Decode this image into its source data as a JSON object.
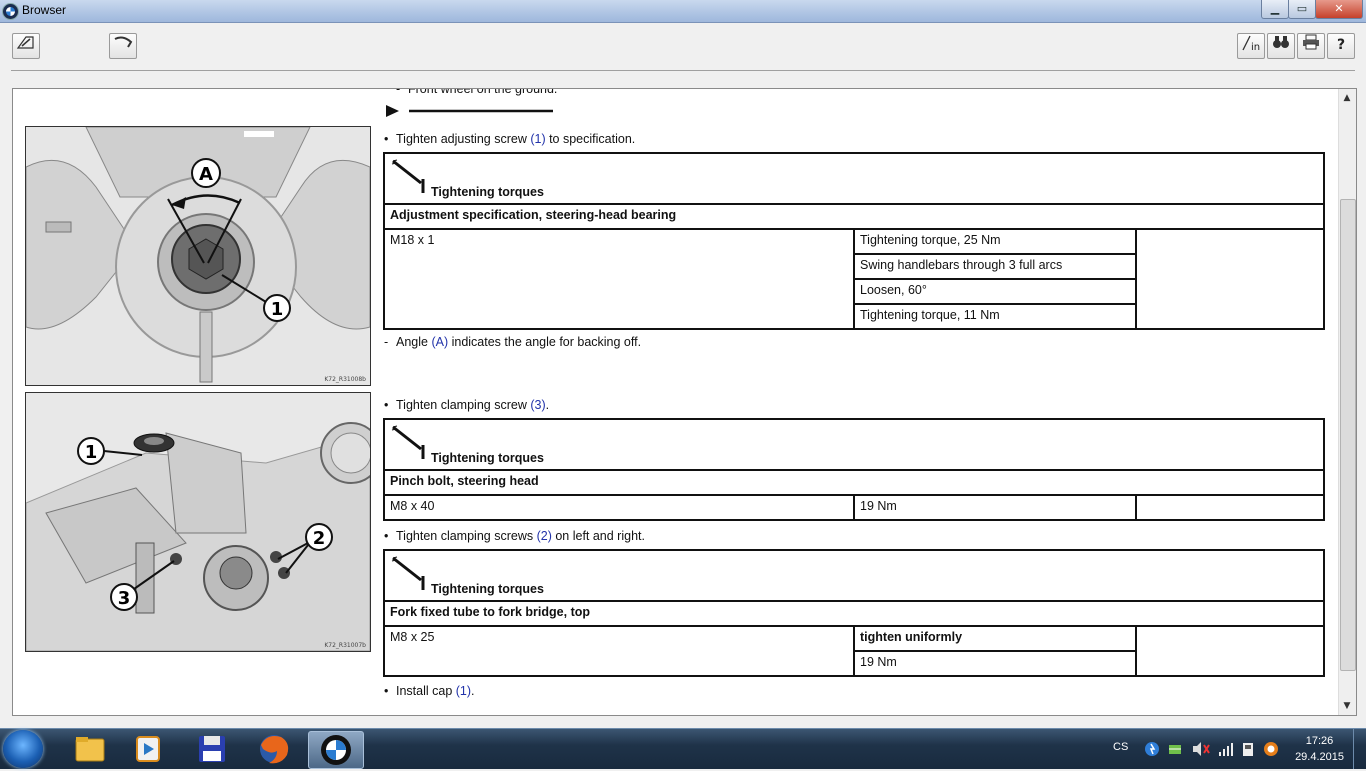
{
  "window": {
    "title": "Browser",
    "minimize": "▁",
    "maximize": "▭",
    "close": "✕"
  },
  "toolbar": {
    "left": [
      {
        "icon": "edit-icon",
        "glyph": "✎"
      },
      {
        "icon": "tool-icon",
        "glyph": "⌐"
      }
    ],
    "right": [
      {
        "icon": "info-in-icon",
        "glyph": "in"
      },
      {
        "icon": "binoculars-icon",
        "glyph": "⌕"
      },
      {
        "icon": "print-icon",
        "glyph": "⎙"
      },
      {
        "icon": "help-icon",
        "glyph": "?"
      }
    ]
  },
  "content": {
    "top_cut_text": "Front wheel on the ground.",
    "figures": [
      {
        "code": "K72_R31008b"
      },
      {
        "code": "K72_R31007b"
      }
    ],
    "step1": {
      "pre": "Tighten adjusting screw ",
      "ref": "(1)",
      "post": " to specification."
    },
    "table1": {
      "header": "Tightening torques",
      "title": "Adjustment specification, steering-head bearing",
      "spec": "M18 x 1",
      "rows": [
        "Tightening torque, 25 Nm",
        "Swing handlebars through 3 full arcs",
        "Loosen, 60°",
        "Tightening torque, 11 Nm"
      ]
    },
    "note": {
      "pre": "Angle ",
      "ref": "(A)",
      "post": " indicates the angle for backing off."
    },
    "step2": {
      "pre": "Tighten clamping screw ",
      "ref": "(3)",
      "post": "."
    },
    "table2": {
      "header": "Tightening torques",
      "title": "Pinch bolt, steering head",
      "spec": "M8 x 40",
      "value": "19 Nm"
    },
    "step3": {
      "pre": "Tighten clamping screws ",
      "ref": "(2)",
      "post": " on left and right."
    },
    "table3": {
      "header": "Tightening torques",
      "title": "Fork fixed tube to fork bridge, top",
      "spec": "M8 x 25",
      "rows": [
        "tighten uniformly",
        "19 Nm"
      ]
    },
    "step4": {
      "pre": "Install cap ",
      "ref": "(1)",
      "post": "."
    },
    "callouts": {
      "a": "A",
      "one": "1",
      "two": "2",
      "three": "3"
    }
  },
  "taskbar": {
    "apps": [
      "windows-explorer",
      "media-player",
      "save-app",
      "firefox",
      "bmw-browser"
    ],
    "language": "CS",
    "time": "17:26",
    "date": "29.4.2015"
  }
}
